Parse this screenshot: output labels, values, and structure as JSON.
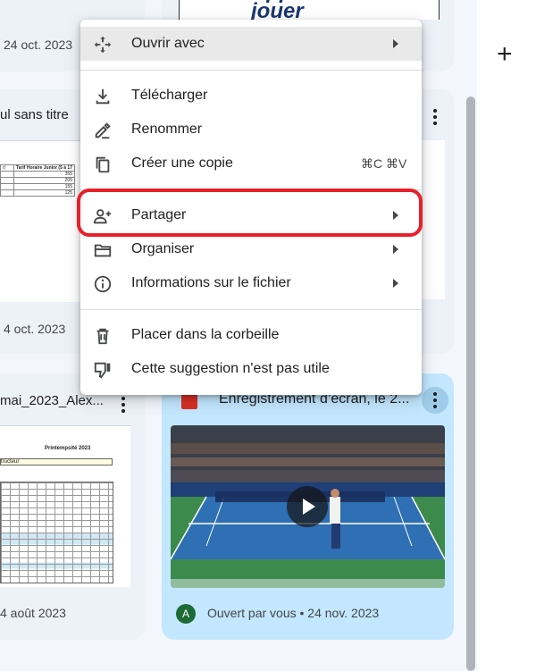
{
  "cards": {
    "top_left_date": "24 oct. 2023",
    "top_right_thumb_text": "Apprendre et jouer",
    "mid_left_title": "ul sans titre",
    "mid_left_date": "4 oct. 2023",
    "sheet1_header": "Tarif Horaire Junior (5 à 17",
    "sheet1_values": [
      "355",
      "205",
      "155",
      "125"
    ],
    "bottom_left_title": "mai_2023_Alex...",
    "bottom_left_date": "4 août 2023",
    "sheet2_title": "Printempsité 2023",
    "sheet2_subtitle": "tructeur",
    "video_card_title": "Enregistrement d’écran, le 2...",
    "video_card_meta": "Ouvert par vous • 24 nov. 2023",
    "avatar_initial": "A"
  },
  "menu": {
    "open_with": "Ouvrir avec",
    "download": "Télécharger",
    "rename": "Renommer",
    "copy": "Créer une copie",
    "copy_shortcut": "⌘C ⌘V",
    "share": "Partager",
    "organize": "Organiser",
    "info": "Informations sur le fichier",
    "trash": "Placer dans la corbeille",
    "not_useful": "Cette suggestion n'est pas utile"
  },
  "right_panel": {
    "plus": "+"
  },
  "colors": {
    "highlight": "#e8202a",
    "blue_card": "#c2e7ff",
    "avatar": "#1e6a36",
    "court": "#2f6fb3"
  },
  "icons": [
    "move-icon",
    "download-icon",
    "rename-icon",
    "copy-icon",
    "share-person-icon",
    "folder-icon",
    "info-icon",
    "trash-icon",
    "thumb-down-icon",
    "play-icon",
    "video-file-icon"
  ]
}
